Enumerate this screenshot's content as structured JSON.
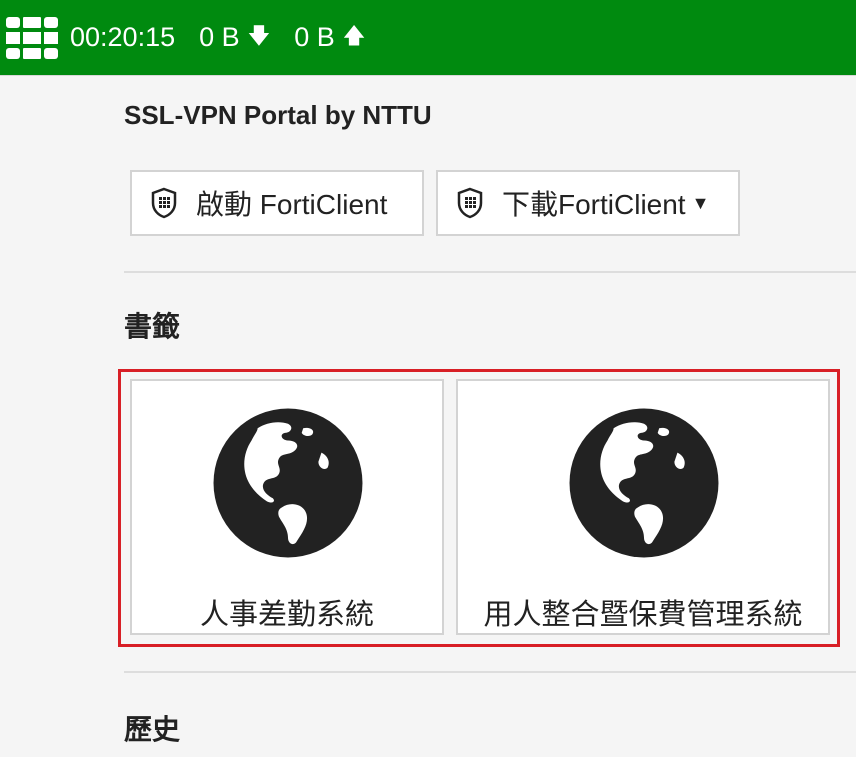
{
  "topbar": {
    "logo_icon": "fortinet-logo-icon",
    "session_time": "00:20:15",
    "download": "0 B",
    "download_icon": "arrow-down-icon",
    "upload": "0 B",
    "upload_icon": "arrow-up-icon",
    "bg_color": "#008a0f"
  },
  "portal": {
    "title": "SSL-VPN Portal by NTTU"
  },
  "buttons": [
    {
      "label": "啟動 FortiClient",
      "icon": "forticlient-shield-icon"
    },
    {
      "label": "下載FortiClient",
      "icon": "forticlient-shield-icon",
      "dropdown_icon": "caret-down-icon"
    }
  ],
  "bookmarks": {
    "heading": "書籤",
    "items": [
      {
        "label": "人事差勤系統",
        "icon": "globe-icon"
      },
      {
        "label": "用人整合暨保費管理系統",
        "icon": "globe-icon"
      }
    ],
    "highlight_color": "#d81f26"
  },
  "history": {
    "heading": "歷史"
  }
}
